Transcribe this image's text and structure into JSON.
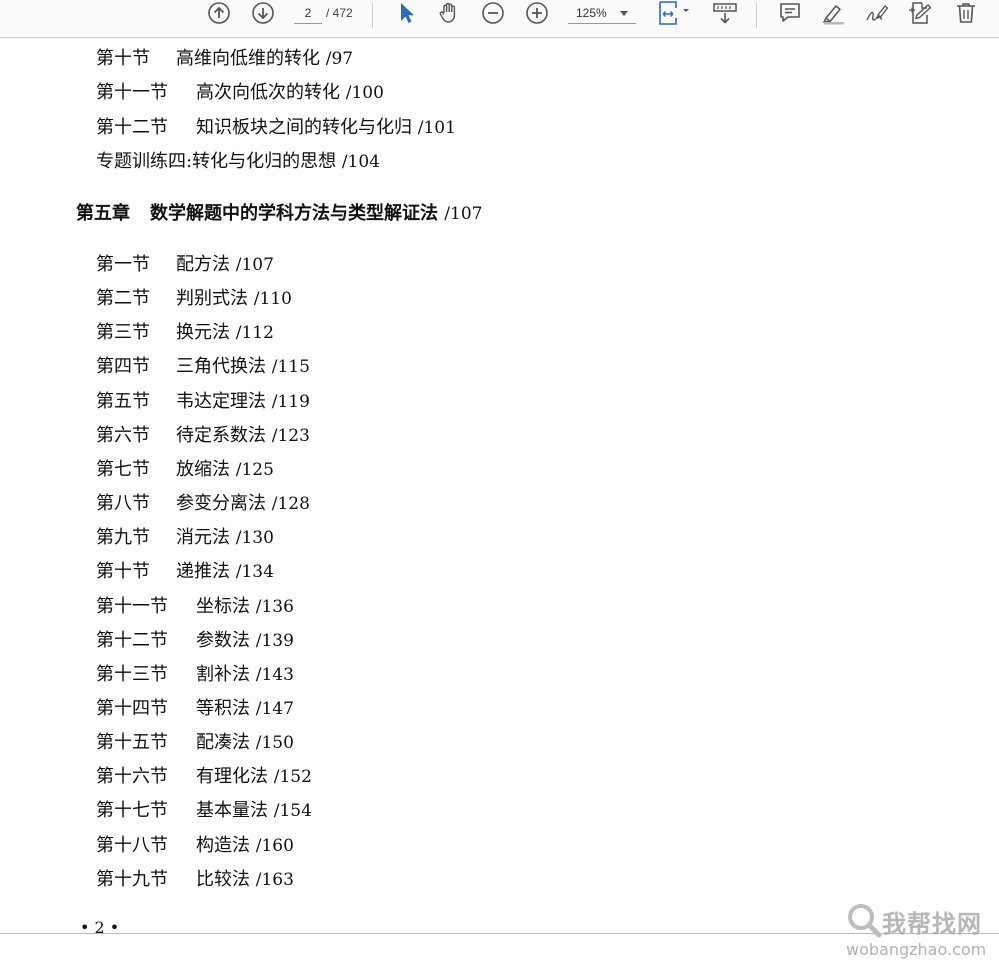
{
  "toolbar": {
    "page_current": "2",
    "page_total": "/ 472",
    "zoom": "125%",
    "icons": [
      "page-up-icon",
      "page-down-icon",
      "zoom-out-icon",
      "zoom-in-icon",
      "select-cursor-icon",
      "hand-tool-icon",
      "fit-page-icon",
      "scroll-mode-icon",
      "comment-icon",
      "highlight-icon",
      "sign-icon",
      "edit-pdf-icon",
      "delete-icon"
    ],
    "accent": "#2d6bb5"
  },
  "document": {
    "top_entries": [
      {
        "section": "第十节",
        "title": "高维向低维的转化",
        "page": "/97"
      },
      {
        "section": "第十一节",
        "title": "高次向低次的转化",
        "page": "/100"
      },
      {
        "section": "第十二节",
        "title": "知识板块之间的转化与化归",
        "page": "/101"
      }
    ],
    "training": {
      "text": "专题训练四:转化与化归的思想",
      "page": "/104"
    },
    "chapter": {
      "label": "第五章",
      "title": "数学解题中的学科方法与类型解证法",
      "page": "/107"
    },
    "entries": [
      {
        "section": "第一节",
        "title": "配方法",
        "page": "/107"
      },
      {
        "section": "第二节",
        "title": "判别式法",
        "page": "/110"
      },
      {
        "section": "第三节",
        "title": "换元法",
        "page": "/112"
      },
      {
        "section": "第四节",
        "title": "三角代换法",
        "page": "/115"
      },
      {
        "section": "第五节",
        "title": "韦达定理法",
        "page": "/119"
      },
      {
        "section": "第六节",
        "title": "待定系数法",
        "page": "/123"
      },
      {
        "section": "第七节",
        "title": "放缩法",
        "page": "/125"
      },
      {
        "section": "第八节",
        "title": "参变分离法",
        "page": "/128"
      },
      {
        "section": "第九节",
        "title": "消元法",
        "page": "/130"
      },
      {
        "section": "第十节",
        "title": "递推法",
        "page": "/134"
      },
      {
        "section": "第十一节",
        "title": "坐标法",
        "page": "/136"
      },
      {
        "section": "第十二节",
        "title": "参数法",
        "page": "/139"
      },
      {
        "section": "第十三节",
        "title": "割补法",
        "page": "/143"
      },
      {
        "section": "第十四节",
        "title": "等积法",
        "page": "/147"
      },
      {
        "section": "第十五节",
        "title": "配凑法",
        "page": "/150"
      },
      {
        "section": "第十六节",
        "title": "有理化法",
        "page": "/152"
      },
      {
        "section": "第十七节",
        "title": "基本量法",
        "page": "/154"
      },
      {
        "section": "第十八节",
        "title": "构造法",
        "page": "/160"
      },
      {
        "section": "第十九节",
        "title": "比较法",
        "page": "/163"
      }
    ],
    "page_number": "• 2 •"
  },
  "watermark": {
    "cn": "我帮找网",
    "url": "wobangzhao.com"
  }
}
